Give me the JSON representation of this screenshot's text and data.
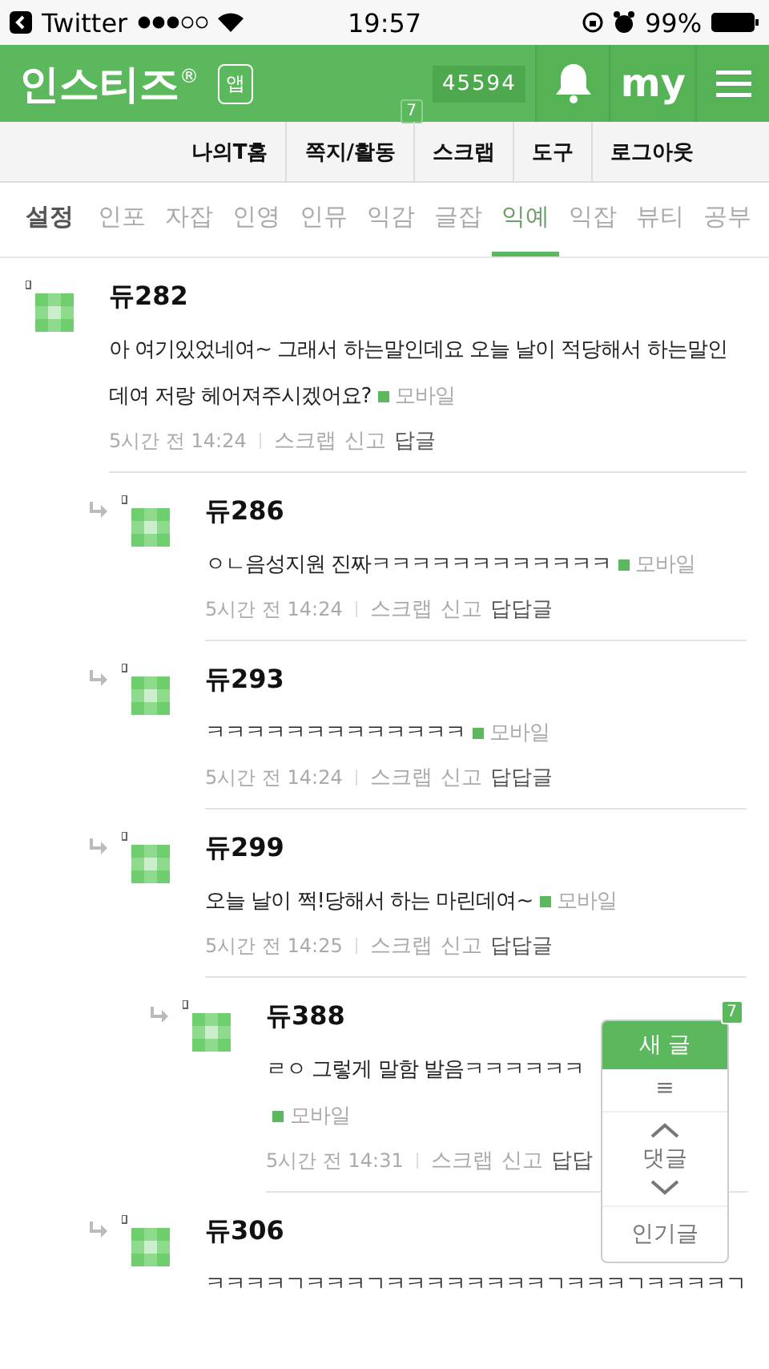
{
  "status_bar": {
    "back_app": "Twitter",
    "time": "19:57",
    "battery": "99%"
  },
  "header": {
    "logo": "인스티즈$^{®}$",
    "app_badge": "앱",
    "count": "45594",
    "my": "my"
  },
  "sub_nav": [
    {
      "label": "나의T홈"
    },
    {
      "label": "쪽지/활동",
      "badge": "7"
    },
    {
      "label": "스크랩"
    },
    {
      "label": "도구"
    },
    {
      "label": "로그아웃"
    }
  ],
  "category_tabs": [
    {
      "label": "설정",
      "kind": "settings",
      "selected": false
    },
    {
      "label": "인포",
      "kind": "tab",
      "selected": false
    },
    {
      "label": "자잡",
      "kind": "tab",
      "selected": false
    },
    {
      "label": "인영",
      "kind": "tab",
      "selected": false
    },
    {
      "label": "인뮤",
      "kind": "tab",
      "selected": false
    },
    {
      "label": "익감",
      "kind": "tab",
      "selected": false
    },
    {
      "label": "글잡",
      "kind": "tab",
      "selected": false
    },
    {
      "label": "익예",
      "kind": "tab",
      "selected": true
    },
    {
      "label": "익잡",
      "kind": "tab",
      "selected": false
    },
    {
      "label": "뷰티",
      "kind": "tab",
      "selected": false
    },
    {
      "label": "공부",
      "kind": "tab",
      "selected": false
    }
  ],
  "comments": [
    {
      "name": "듀282",
      "body": "아 여기있었네여~ 그래서 하는말인데요 오늘 날이 적당해서 하는말인데여 저랑 헤어져주시겠어요?",
      "tag": "모바일",
      "time": "5시간 전  14:24",
      "actions": [
        {
          "label": "스크랩",
          "kind": "link"
        },
        {
          "label": "신고",
          "kind": "link"
        },
        {
          "label": "답글",
          "kind": "reply"
        }
      ],
      "children": [
        {
          "name": "듀286",
          "body": "ㅇㄴ음성지원 진짜ㅋㅋㅋㅋㅋㅋㅋㅋㅋㅋㅋㅋ",
          "tag": "모바일",
          "time": "5시간 전  14:24",
          "actions": [
            {
              "label": "스크랩",
              "kind": "link"
            },
            {
              "label": "신고",
              "kind": "link"
            },
            {
              "label": "답답글",
              "kind": "reply"
            }
          ]
        },
        {
          "name": "듀293",
          "body": "ㅋㅋㅋㅋㅋㅋㅋㅋㅋㅋㅋㅋㅋ",
          "tag": "모바일",
          "time": "5시간 전  14:24",
          "actions": [
            {
              "label": "스크랩",
              "kind": "link"
            },
            {
              "label": "신고",
              "kind": "link"
            },
            {
              "label": "답답글",
              "kind": "reply"
            }
          ]
        },
        {
          "name": "듀299",
          "body": "오늘 날이 쩍!당해서 하는 마린데여~",
          "tag": "모바일",
          "time": "5시간 전  14:25",
          "actions": [
            {
              "label": "스크랩",
              "kind": "link"
            },
            {
              "label": "신고",
              "kind": "link"
            },
            {
              "label": "답답글",
              "kind": "reply"
            }
          ],
          "children": [
            {
              "name": "듀388",
              "body": "ㄹㅇ 그렇게 말함 발음ㅋㅋㅋㅋㅋㅋ",
              "tag": "모바일",
              "time": "5시간 전  14:31",
              "actions": [
                {
                  "label": "스크랩",
                  "kind": "link"
                },
                {
                  "label": "신고",
                  "kind": "link"
                },
                {
                  "label": "답답",
                  "kind": "reply"
                }
              ]
            }
          ]
        },
        {
          "name": "듀306",
          "body": "ㅋㅋㅋㅋㄱㅋㅋㅋㄱㅋㅋㅋㅋㅋㅋㅋㅋㄱㅋㅋㅋㄱㅋㅋㅋㅋㄱ"
        }
      ]
    }
  ],
  "float_panel": {
    "new_post": "새 글",
    "badge": "7",
    "list": "≡",
    "comments": "댓글",
    "popular": "인기글"
  }
}
